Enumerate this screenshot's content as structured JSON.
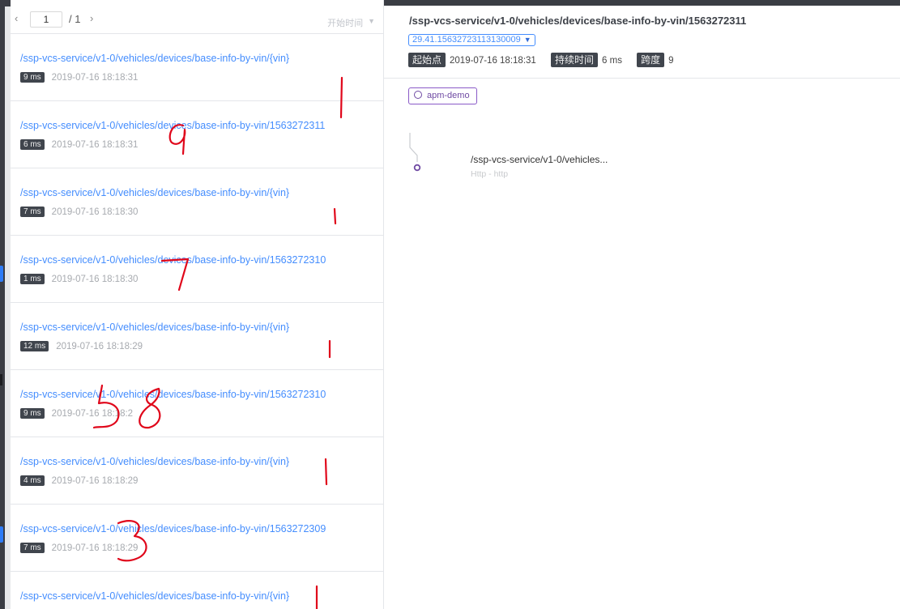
{
  "pager": {
    "prev": "‹",
    "current_page": "1",
    "total": "/ 1",
    "next": "›",
    "sort_label": "开始时间",
    "sort_caret": "▼"
  },
  "traces": [
    {
      "endpoint": "/ssp-vcs-service/v1-0/vehicles/devices/base-info-by-vin/{vin}",
      "duration": "9 ms",
      "time": "2019-07-16 18:18:31"
    },
    {
      "endpoint": "/ssp-vcs-service/v1-0/vehicles/devices/base-info-by-vin/1563272311",
      "duration": "6 ms",
      "time": "2019-07-16 18:18:31"
    },
    {
      "endpoint": "/ssp-vcs-service/v1-0/vehicles/devices/base-info-by-vin/{vin}",
      "duration": "7 ms",
      "time": "2019-07-16 18:18:30"
    },
    {
      "endpoint": "/ssp-vcs-service/v1-0/vehicles/devices/base-info-by-vin/1563272310",
      "duration": "1 ms",
      "time": "2019-07-16 18:18:30"
    },
    {
      "endpoint": "/ssp-vcs-service/v1-0/vehicles/devices/base-info-by-vin/{vin}",
      "duration": "12 ms",
      "time": "2019-07-16 18:18:29"
    },
    {
      "endpoint": "/ssp-vcs-service/v1-0/vehicles/devices/base-info-by-vin/1563272310",
      "duration": "9 ms",
      "time": "2019-07-16 18:18:2"
    },
    {
      "endpoint": "/ssp-vcs-service/v1-0/vehicles/devices/base-info-by-vin/{vin}",
      "duration": "4 ms",
      "time": "2019-07-16 18:18:29"
    },
    {
      "endpoint": "/ssp-vcs-service/v1-0/vehicles/devices/base-info-by-vin/1563272309",
      "duration": "7 ms",
      "time": "2019-07-16 18:18:29"
    },
    {
      "endpoint": "/ssp-vcs-service/v1-0/vehicles/devices/base-info-by-vin/{vin}",
      "duration": "",
      "time": ""
    }
  ],
  "detail": {
    "title": "/ssp-vcs-service/v1-0/vehicles/devices/base-info-by-vin/1563272311",
    "trace_id": "29.41.15632723113130009",
    "trace_id_caret": "▼",
    "start_label": "起始点",
    "start_value": "2019-07-16 18:18:31",
    "duration_label": "持续时间",
    "duration_value": "6 ms",
    "span_label": "跨度",
    "span_value": "9",
    "service": "apm-demo",
    "span_name": "/ssp-vcs-service/v1-0/vehicles...",
    "span_type": "Http - http"
  },
  "colors": {
    "link": "#448dfe",
    "badge_bg": "#40454d",
    "service_purple": "#6f4aa3",
    "annotation_red": "#e0061a"
  },
  "annotations": [
    "1",
    "9",
    "1",
    "7",
    "1",
    "5",
    "8",
    "1",
    "3",
    "1"
  ]
}
